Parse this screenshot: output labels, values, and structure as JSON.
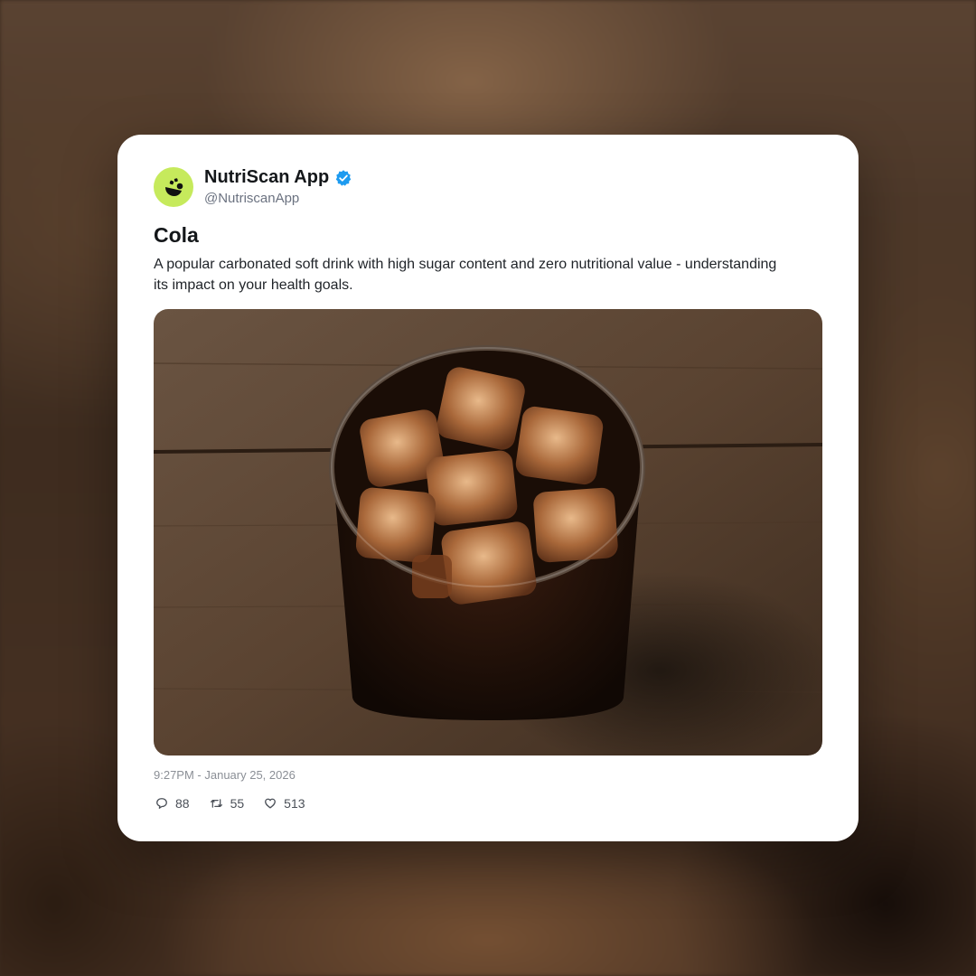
{
  "post": {
    "author_name": "NutriScan App",
    "author_handle": "@NutriscanApp",
    "verified": true,
    "title": "Cola",
    "description": "A popular carbonated soft drink with high sugar content and zero nutritional value - understanding its impact on your health goals.",
    "timestamp": "9:27PM - January 25, 2026",
    "stats": {
      "replies": "88",
      "reposts": "55",
      "likes": "513"
    }
  },
  "icons": {
    "avatar": "nutriscan-logo-icon",
    "verified": "verified-badge-icon",
    "reply": "comment-icon",
    "repost": "repost-icon",
    "like": "heart-icon"
  },
  "colors": {
    "avatar_bg": "#c6ea5c",
    "verified_blue": "#1d9bf0",
    "text_primary": "#14171a",
    "text_muted": "#8b8f96"
  }
}
